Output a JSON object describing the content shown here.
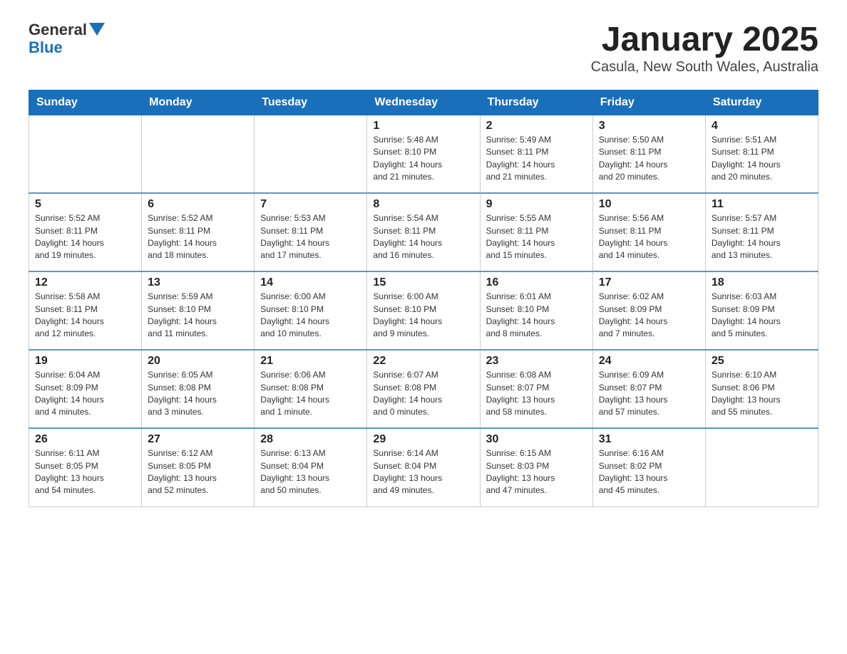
{
  "logo": {
    "name_black": "General",
    "name_blue": "Blue"
  },
  "title": "January 2025",
  "subtitle": "Casula, New South Wales, Australia",
  "days_of_week": [
    "Sunday",
    "Monday",
    "Tuesday",
    "Wednesday",
    "Thursday",
    "Friday",
    "Saturday"
  ],
  "weeks": [
    [
      {
        "day": "",
        "info": ""
      },
      {
        "day": "",
        "info": ""
      },
      {
        "day": "",
        "info": ""
      },
      {
        "day": "1",
        "info": "Sunrise: 5:48 AM\nSunset: 8:10 PM\nDaylight: 14 hours\nand 21 minutes."
      },
      {
        "day": "2",
        "info": "Sunrise: 5:49 AM\nSunset: 8:11 PM\nDaylight: 14 hours\nand 21 minutes."
      },
      {
        "day": "3",
        "info": "Sunrise: 5:50 AM\nSunset: 8:11 PM\nDaylight: 14 hours\nand 20 minutes."
      },
      {
        "day": "4",
        "info": "Sunrise: 5:51 AM\nSunset: 8:11 PM\nDaylight: 14 hours\nand 20 minutes."
      }
    ],
    [
      {
        "day": "5",
        "info": "Sunrise: 5:52 AM\nSunset: 8:11 PM\nDaylight: 14 hours\nand 19 minutes."
      },
      {
        "day": "6",
        "info": "Sunrise: 5:52 AM\nSunset: 8:11 PM\nDaylight: 14 hours\nand 18 minutes."
      },
      {
        "day": "7",
        "info": "Sunrise: 5:53 AM\nSunset: 8:11 PM\nDaylight: 14 hours\nand 17 minutes."
      },
      {
        "day": "8",
        "info": "Sunrise: 5:54 AM\nSunset: 8:11 PM\nDaylight: 14 hours\nand 16 minutes."
      },
      {
        "day": "9",
        "info": "Sunrise: 5:55 AM\nSunset: 8:11 PM\nDaylight: 14 hours\nand 15 minutes."
      },
      {
        "day": "10",
        "info": "Sunrise: 5:56 AM\nSunset: 8:11 PM\nDaylight: 14 hours\nand 14 minutes."
      },
      {
        "day": "11",
        "info": "Sunrise: 5:57 AM\nSunset: 8:11 PM\nDaylight: 14 hours\nand 13 minutes."
      }
    ],
    [
      {
        "day": "12",
        "info": "Sunrise: 5:58 AM\nSunset: 8:11 PM\nDaylight: 14 hours\nand 12 minutes."
      },
      {
        "day": "13",
        "info": "Sunrise: 5:59 AM\nSunset: 8:10 PM\nDaylight: 14 hours\nand 11 minutes."
      },
      {
        "day": "14",
        "info": "Sunrise: 6:00 AM\nSunset: 8:10 PM\nDaylight: 14 hours\nand 10 minutes."
      },
      {
        "day": "15",
        "info": "Sunrise: 6:00 AM\nSunset: 8:10 PM\nDaylight: 14 hours\nand 9 minutes."
      },
      {
        "day": "16",
        "info": "Sunrise: 6:01 AM\nSunset: 8:10 PM\nDaylight: 14 hours\nand 8 minutes."
      },
      {
        "day": "17",
        "info": "Sunrise: 6:02 AM\nSunset: 8:09 PM\nDaylight: 14 hours\nand 7 minutes."
      },
      {
        "day": "18",
        "info": "Sunrise: 6:03 AM\nSunset: 8:09 PM\nDaylight: 14 hours\nand 5 minutes."
      }
    ],
    [
      {
        "day": "19",
        "info": "Sunrise: 6:04 AM\nSunset: 8:09 PM\nDaylight: 14 hours\nand 4 minutes."
      },
      {
        "day": "20",
        "info": "Sunrise: 6:05 AM\nSunset: 8:08 PM\nDaylight: 14 hours\nand 3 minutes."
      },
      {
        "day": "21",
        "info": "Sunrise: 6:06 AM\nSunset: 8:08 PM\nDaylight: 14 hours\nand 1 minute."
      },
      {
        "day": "22",
        "info": "Sunrise: 6:07 AM\nSunset: 8:08 PM\nDaylight: 14 hours\nand 0 minutes."
      },
      {
        "day": "23",
        "info": "Sunrise: 6:08 AM\nSunset: 8:07 PM\nDaylight: 13 hours\nand 58 minutes."
      },
      {
        "day": "24",
        "info": "Sunrise: 6:09 AM\nSunset: 8:07 PM\nDaylight: 13 hours\nand 57 minutes."
      },
      {
        "day": "25",
        "info": "Sunrise: 6:10 AM\nSunset: 8:06 PM\nDaylight: 13 hours\nand 55 minutes."
      }
    ],
    [
      {
        "day": "26",
        "info": "Sunrise: 6:11 AM\nSunset: 8:05 PM\nDaylight: 13 hours\nand 54 minutes."
      },
      {
        "day": "27",
        "info": "Sunrise: 6:12 AM\nSunset: 8:05 PM\nDaylight: 13 hours\nand 52 minutes."
      },
      {
        "day": "28",
        "info": "Sunrise: 6:13 AM\nSunset: 8:04 PM\nDaylight: 13 hours\nand 50 minutes."
      },
      {
        "day": "29",
        "info": "Sunrise: 6:14 AM\nSunset: 8:04 PM\nDaylight: 13 hours\nand 49 minutes."
      },
      {
        "day": "30",
        "info": "Sunrise: 6:15 AM\nSunset: 8:03 PM\nDaylight: 13 hours\nand 47 minutes."
      },
      {
        "day": "31",
        "info": "Sunrise: 6:16 AM\nSunset: 8:02 PM\nDaylight: 13 hours\nand 45 minutes."
      },
      {
        "day": "",
        "info": ""
      }
    ]
  ]
}
